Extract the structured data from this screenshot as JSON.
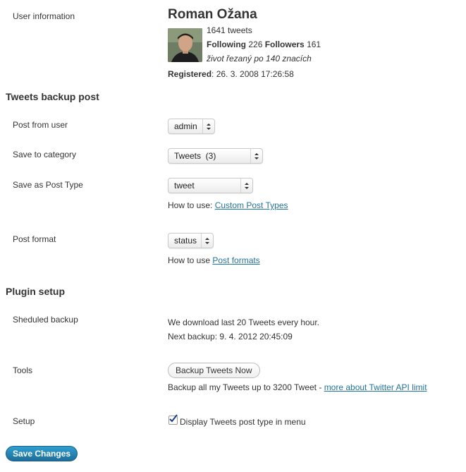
{
  "user": {
    "label": "User information",
    "name": "Roman Ožana",
    "tweets": "1641 tweets",
    "following_label": "Following",
    "following_count": "226",
    "followers_label": "Followers",
    "followers_count": "161",
    "bio": "život řezaný po 140 znacích",
    "registered_label": "Registered",
    "registered_value": ": 26. 3. 2008 17:26:58"
  },
  "backup_post": {
    "title": "Tweets backup post",
    "post_from_user": {
      "label": "Post from user",
      "value": "admin"
    },
    "category": {
      "label": "Save to category",
      "value": "Tweets  (3)"
    },
    "post_type": {
      "label": "Save as Post Type",
      "value": "tweet",
      "help_prefix": "How to use: ",
      "help_link": "Custom Post Types"
    },
    "post_format": {
      "label": "Post format",
      "value": "status",
      "help_prefix": "How to use ",
      "help_link": "Post formats"
    }
  },
  "plugin_setup": {
    "title": "Plugin setup",
    "scheduled": {
      "label": "Sheduled backup",
      "line1": "We download last 20 Tweets every hour.",
      "line2": "Next backup: 9. 4. 2012 20:45:09"
    },
    "tools": {
      "label": "Tools",
      "button": "Backup Tweets Now",
      "note_prefix": "Backup all my Tweets up to 3200 Tweet - ",
      "note_link": "more about Twitter API limit"
    },
    "setup": {
      "label": "Setup",
      "checkbox_label": "Display Tweets post type in menu",
      "checked": true
    }
  },
  "save_button": "Save Changes"
}
